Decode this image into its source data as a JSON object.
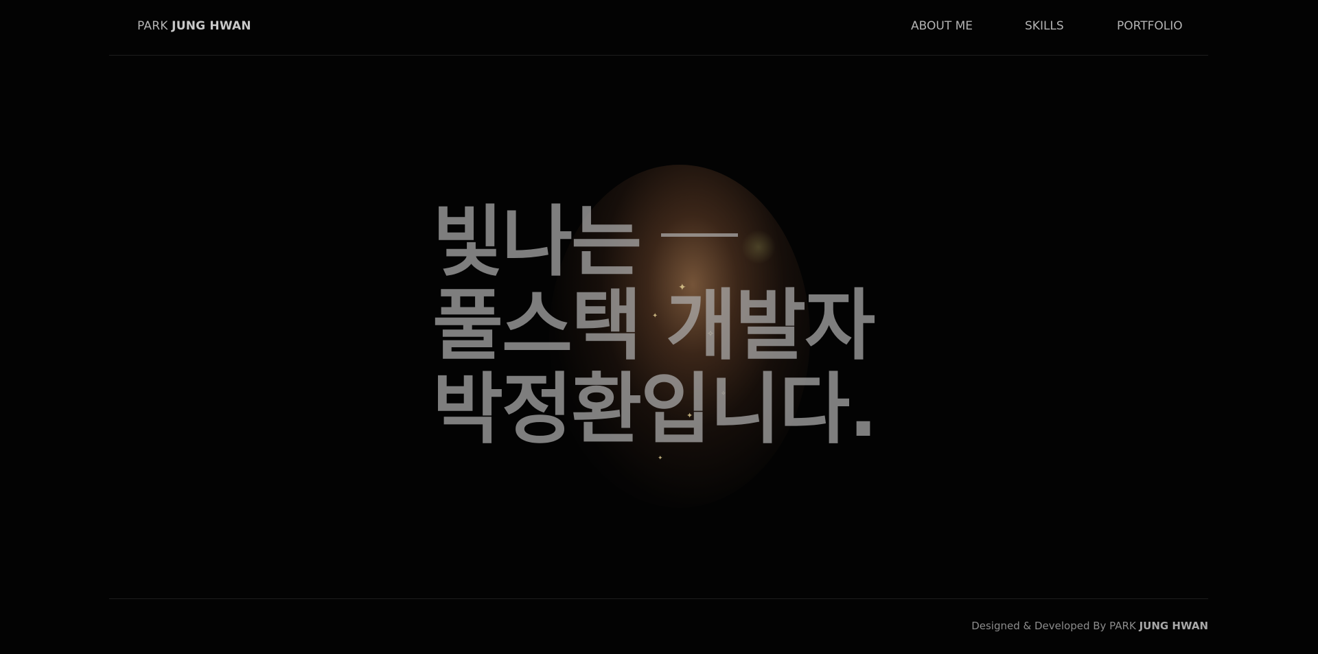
{
  "header": {
    "logo_light": "PARK ",
    "logo_bold": "JUNG HWAN",
    "nav": [
      "ABOUT ME",
      "SKILLS",
      "PORTFOLIO"
    ]
  },
  "hero": {
    "line1": "빛나는",
    "line2": "풀스택 개발자",
    "line3": "박정환입니다."
  },
  "footer": {
    "credit_prefix": "Designed & Developed By PARK ",
    "credit_bold": "JUNG HWAN"
  },
  "colors": {
    "background": "#030303",
    "text": "#b4b4b4",
    "glow": "#d2966a"
  }
}
